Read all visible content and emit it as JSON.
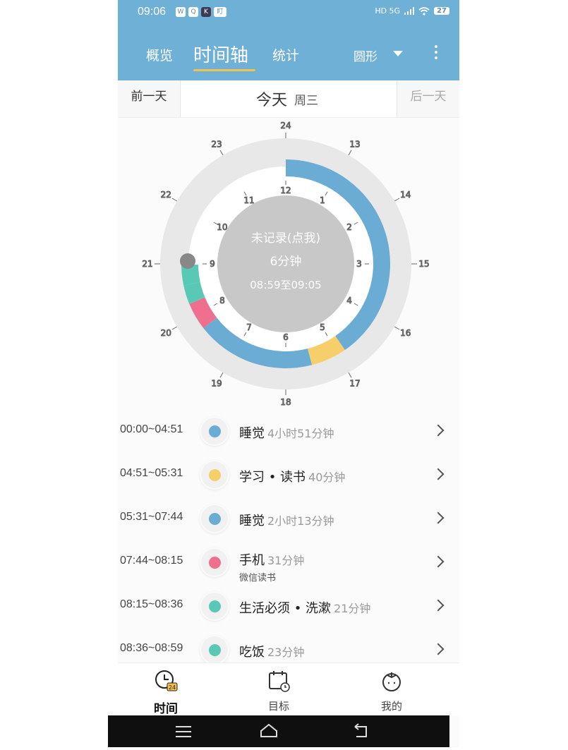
{
  "status_bar": {
    "time": "09:06",
    "app_icons": [
      "W",
      "Q",
      "K",
      "盯"
    ],
    "network": "HD 5G",
    "battery": "27"
  },
  "header": {
    "tabs": [
      {
        "label": "概览"
      },
      {
        "label": "时间轴"
      },
      {
        "label": "统计"
      }
    ],
    "active_tab": "时间轴",
    "view_select": "圆形"
  },
  "day_nav": {
    "prev_label": "前一天",
    "today_label": "今天",
    "weekday": "周三",
    "next_label": "后一天"
  },
  "clock": {
    "outer_hour_labels": [
      "13",
      "14",
      "15",
      "16",
      "17",
      "18",
      "19",
      "20",
      "21",
      "22",
      "23",
      "24"
    ],
    "inner_hour_labels": [
      "1",
      "2",
      "3",
      "4",
      "5",
      "6",
      "7",
      "8",
      "9",
      "10",
      "11",
      "12"
    ],
    "center_title": "未记录(点我)",
    "center_duration": "6分钟",
    "center_range": "08:59至09:05",
    "colors": {
      "sleep": "#6aacd3",
      "study": "#f7cf6a",
      "phone": "#ef6f8f",
      "life": "#59c9b6",
      "ring_bg": "#e8e8e8",
      "center": "#c8c8c8"
    }
  },
  "records": [
    {
      "time": "00:00~04:51",
      "title": "睡觉",
      "duration": "4小时51分钟",
      "sub": "",
      "color": "#6aacd3"
    },
    {
      "time": "04:51~05:31",
      "title": "学习 • 读书",
      "duration": "40分钟",
      "sub": "",
      "color": "#f7cf6a"
    },
    {
      "time": "05:31~07:44",
      "title": "睡觉",
      "duration": "2小时13分钟",
      "sub": "",
      "color": "#6aacd3"
    },
    {
      "time": "07:44~08:15",
      "title": "手机",
      "duration": "31分钟",
      "sub": "微信读书",
      "color": "#ef6f8f"
    },
    {
      "time": "08:15~08:36",
      "title": "生活必须 • 洗漱",
      "duration": "21分钟",
      "sub": "",
      "color": "#59c9b6"
    },
    {
      "time": "08:36~08:59",
      "title": "吃饭",
      "duration": "23分钟",
      "sub": "",
      "color": "#59c9b6"
    }
  ],
  "bottom_nav": [
    {
      "label": "时间",
      "icon": "clock-24-icon"
    },
    {
      "label": "目标",
      "icon": "calendar-target-icon"
    },
    {
      "label": "我的",
      "icon": "tomato-icon"
    }
  ]
}
